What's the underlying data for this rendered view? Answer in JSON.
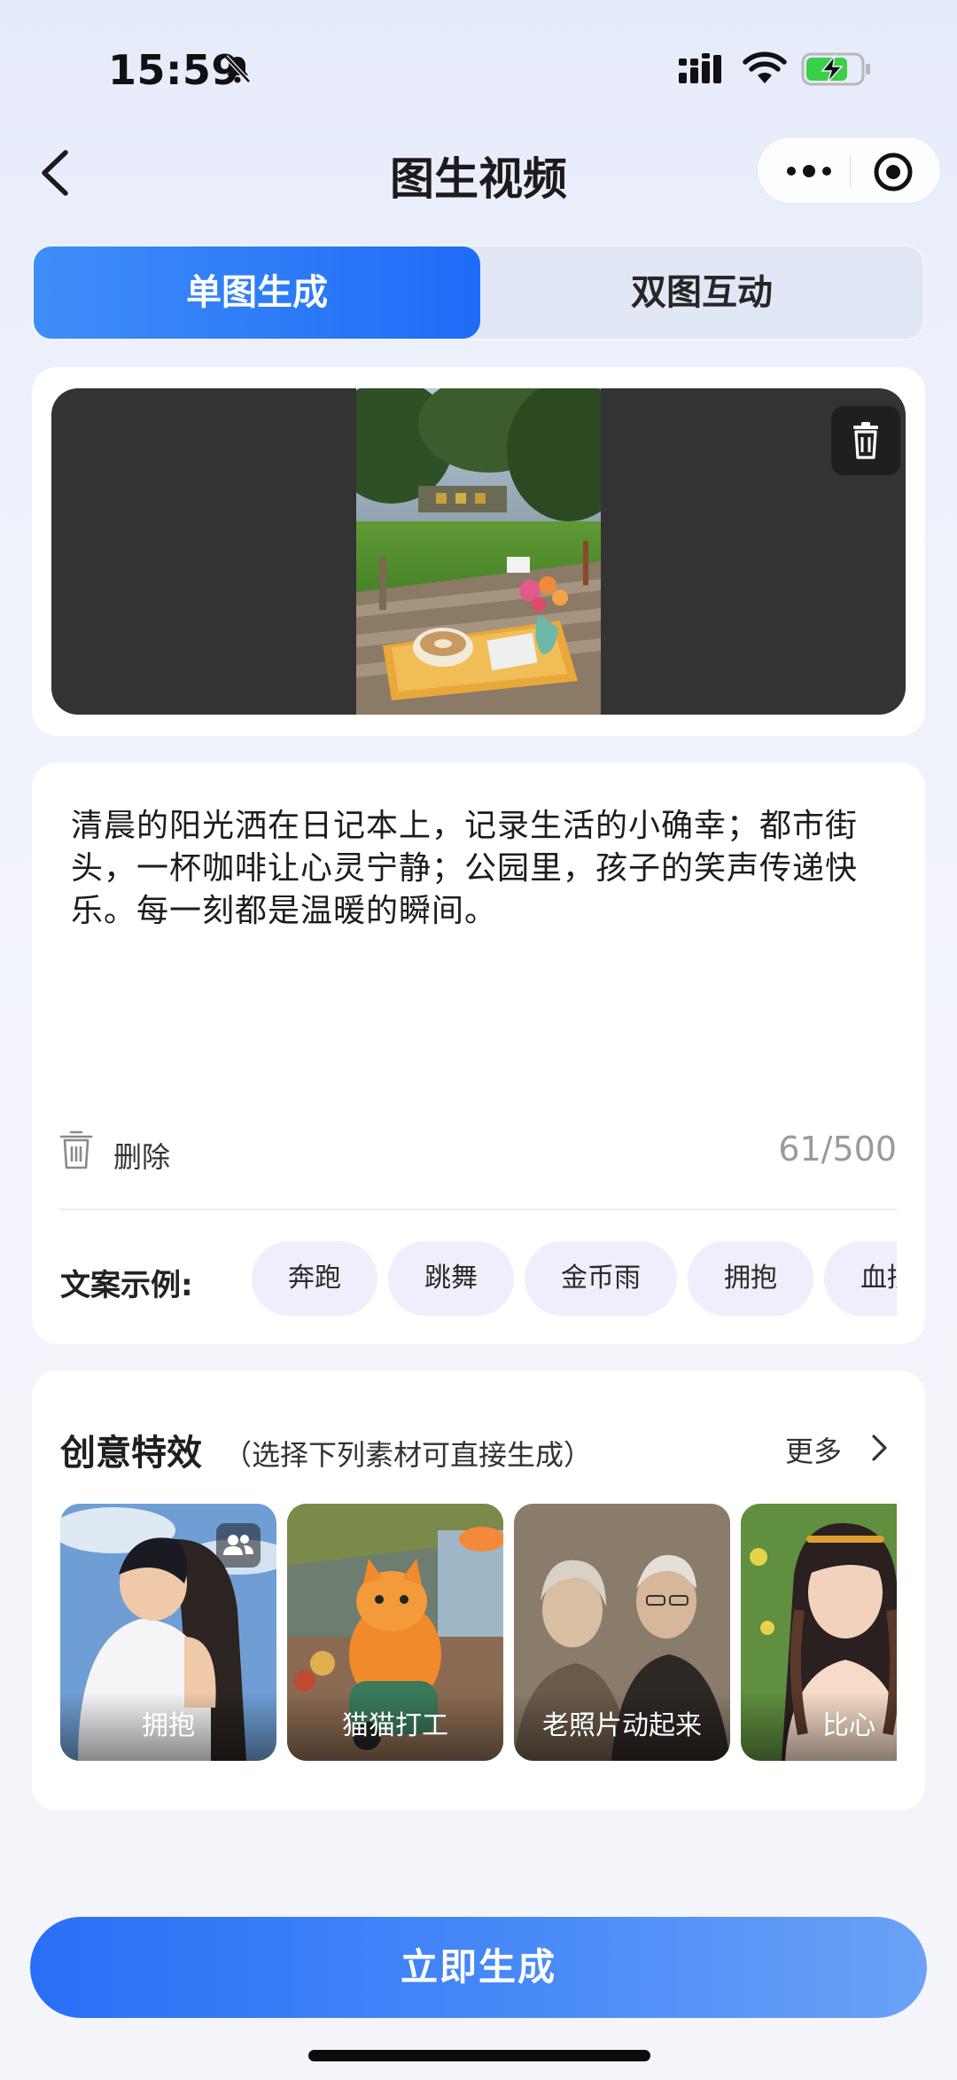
{
  "status_bar": {
    "time": "15:59",
    "icons": [
      "bell-slash-icon",
      "cellular-signal-icon",
      "wifi-icon",
      "battery-charging-icon"
    ],
    "battery_color": "#3bcf4a"
  },
  "header": {
    "title": "图生视频",
    "back_icon": "chevron-left-icon",
    "capsule_icons": [
      "more-dots-icon",
      "target-icon"
    ]
  },
  "tabs": [
    {
      "label": "单图生成",
      "active": true
    },
    {
      "label": "双图互动",
      "active": false
    }
  ],
  "upload": {
    "delete_icon": "trash-icon"
  },
  "prompt": {
    "text": "清晨的阳光洒在日记本上，记录生活的小确幸；都市街头，一杯咖啡让心灵宁静；公园里，孩子的笑声传递快乐。每一刻都是温暖的瞬间。",
    "clear_label": "删除",
    "char_count": "61/500"
  },
  "examples": {
    "label": "文案示例:",
    "chips": [
      "奔跑",
      "跳舞",
      "金币雨",
      "拥抱",
      "血拼"
    ]
  },
  "effects": {
    "title": "创意特效",
    "subtitle": "（选择下列素材可直接生成）",
    "more_label": "更多",
    "tiles": [
      {
        "label": "拥抱",
        "badge_icon": "two-people-icon"
      },
      {
        "label": "猫猫打工"
      },
      {
        "label": "老照片动起来"
      },
      {
        "label": "比心"
      }
    ]
  },
  "primary_action": {
    "label": "立即生成"
  },
  "colors": {
    "accent": "#1e6cf7",
    "chip_bg": "#eeeefc",
    "page_bg": "#eef1fb"
  }
}
